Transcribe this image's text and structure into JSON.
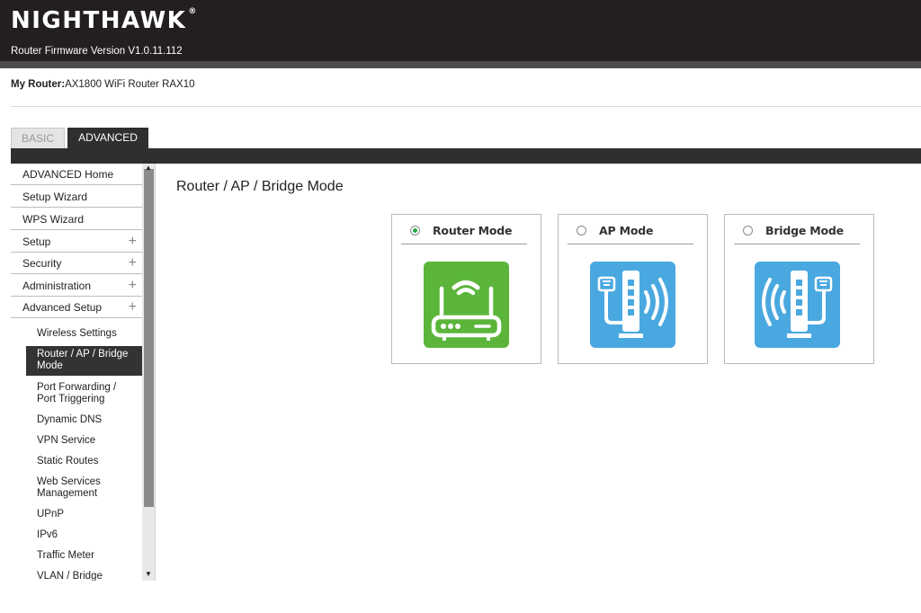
{
  "header": {
    "brand": "NIGHTHAWK",
    "trademark": "®",
    "firmware": "Router Firmware Version V1.0.11.112"
  },
  "router_info": {
    "label": "My Router:",
    "value": "AX1800 WiFi Router RAX10"
  },
  "tabs": [
    {
      "label": "BASIC",
      "active": false
    },
    {
      "label": "ADVANCED",
      "active": true
    }
  ],
  "sidebar": {
    "items": [
      {
        "label": "ADVANCED Home",
        "expandable": false
      },
      {
        "label": "Setup Wizard",
        "expandable": false
      },
      {
        "label": "WPS Wizard",
        "expandable": false
      },
      {
        "label": "Setup",
        "expandable": true
      },
      {
        "label": "Security",
        "expandable": true
      },
      {
        "label": "Administration",
        "expandable": true
      },
      {
        "label": "Advanced Setup",
        "expandable": true
      }
    ],
    "expand_glyph": "+",
    "subitems": [
      {
        "lines": [
          "Wireless Settings"
        ],
        "active": false
      },
      {
        "lines": [
          "Router / AP / Bridge",
          "Mode"
        ],
        "active": true
      },
      {
        "lines": [
          "Port Forwarding /",
          "Port Triggering"
        ],
        "active": false
      },
      {
        "lines": [
          "Dynamic DNS"
        ],
        "active": false
      },
      {
        "lines": [
          "VPN Service"
        ],
        "active": false
      },
      {
        "lines": [
          "Static Routes"
        ],
        "active": false
      },
      {
        "lines": [
          "Web Services",
          "Management"
        ],
        "active": false
      },
      {
        "lines": [
          "UPnP"
        ],
        "active": false
      },
      {
        "lines": [
          "IPv6"
        ],
        "active": false
      },
      {
        "lines": [
          "Traffic Meter"
        ],
        "active": false
      },
      {
        "lines": [
          "VLAN / Bridge"
        ],
        "active": false
      }
    ],
    "scroll_up_glyph": "▲",
    "scroll_down_glyph": "▼"
  },
  "main": {
    "title": "Router / AP / Bridge Mode",
    "modes": [
      {
        "label": "Router Mode",
        "selected": true,
        "icon": "router-icon",
        "tile_color": "#5bb53a"
      },
      {
        "label": "AP Mode",
        "selected": false,
        "icon": "access-point-icon",
        "tile_color": "#4aa8e0"
      },
      {
        "label": "Bridge Mode",
        "selected": false,
        "icon": "bridge-icon",
        "tile_color": "#4aa8e0"
      }
    ]
  },
  "colors": {
    "header_bg": "#231f20",
    "tab_active_bg": "#2f2f2f",
    "radio_selected": "#27a84b"
  }
}
